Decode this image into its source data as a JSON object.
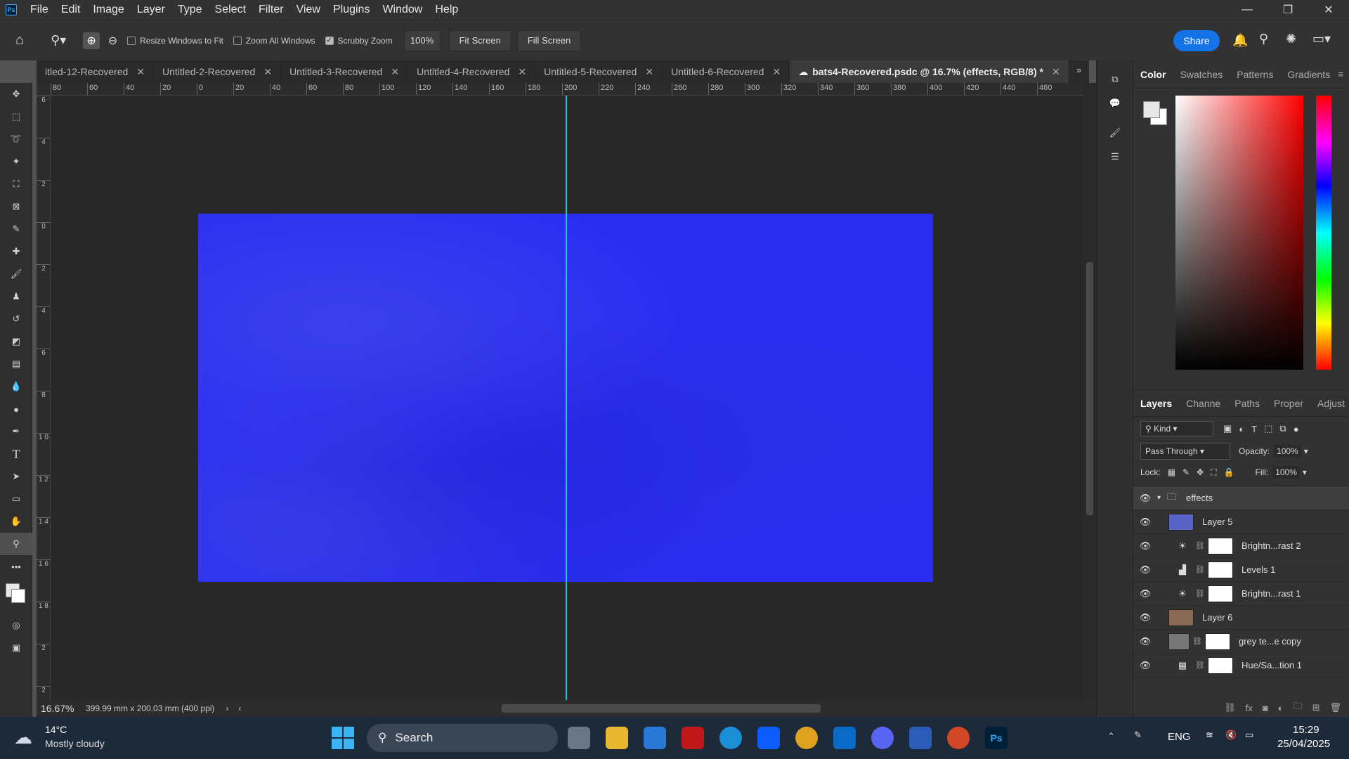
{
  "menubar": {
    "logo": "Ps",
    "items": [
      "File",
      "Edit",
      "Image",
      "Layer",
      "Type",
      "Select",
      "Filter",
      "View",
      "Plugins",
      "Window",
      "Help"
    ],
    "window_controls": [
      "—",
      "❐",
      "✕"
    ]
  },
  "options": {
    "resize_windows": "Resize Windows to Fit",
    "zoom_all": "Zoom All Windows",
    "scrubby_zoom": "Scrubby Zoom",
    "zoom_value": "100%",
    "fit_screen": "Fit Screen",
    "fill_screen": "Fill Screen",
    "share": "Share"
  },
  "tabs": [
    {
      "label": "itled-12-Recovered",
      "active": false
    },
    {
      "label": "Untitled-2-Recovered",
      "active": false
    },
    {
      "label": "Untitled-3-Recovered",
      "active": false
    },
    {
      "label": "Untitled-4-Recovered",
      "active": false
    },
    {
      "label": "Untitled-5-Recovered",
      "active": false
    },
    {
      "label": "Untitled-6-Recovered",
      "active": false
    },
    {
      "label": "bats4-Recovered.psdc @ 16.7% (effects, RGB/8) *",
      "active": true
    }
  ],
  "ruler": {
    "h_ticks": [
      "80",
      "60",
      "40",
      "20",
      "0",
      "20",
      "40",
      "60",
      "80",
      "100",
      "120",
      "140",
      "160",
      "180",
      "200",
      "220",
      "240",
      "260",
      "280",
      "300",
      "320",
      "340",
      "360",
      "380",
      "400",
      "420",
      "440",
      "460"
    ],
    "v_ticks": [
      "6",
      "4",
      "2",
      "0",
      "2",
      "4",
      "6",
      "8",
      "1 0",
      "1 2",
      "1 4",
      "1 6",
      "1 8",
      "2",
      "2"
    ]
  },
  "status": {
    "zoom": "16.67%",
    "doc_size": "399.99 mm x 200.03 mm (400 ppi)"
  },
  "color_panel": {
    "tabs": [
      "Color",
      "Swatches",
      "Patterns",
      "Gradients"
    ],
    "foreground": "#e8e8e8",
    "background": "#ffffff"
  },
  "layers_panel": {
    "tabs": [
      "Layers",
      "Channe",
      "Paths",
      "Proper",
      "Adjust"
    ],
    "filter_kind": "Kind",
    "blend_mode": "Pass Through",
    "opacity_label": "Opacity:",
    "opacity": "100%",
    "lock_label": "Lock:",
    "fill_label": "Fill:",
    "fill": "100%",
    "layers": [
      {
        "name": "effects",
        "kind": "group"
      },
      {
        "name": "Layer 5",
        "kind": "pixel",
        "color": "#5a63c8"
      },
      {
        "name": "Brightn...rast 2",
        "kind": "adjust",
        "icon": "☀"
      },
      {
        "name": "Levels 1",
        "kind": "adjust",
        "icon": "▟"
      },
      {
        "name": "Brightn...rast 1",
        "kind": "adjust",
        "icon": "☀"
      },
      {
        "name": "Layer 6",
        "kind": "pixel",
        "color": "#8a6a55"
      },
      {
        "name": "grey te...e copy",
        "kind": "smart",
        "color": "#777777"
      },
      {
        "name": "Hue/Sa...tion 1",
        "kind": "adjust",
        "icon": "▦"
      }
    ]
  },
  "taskbar": {
    "weather_temp": "14°C",
    "weather_desc": "Mostly cloudy",
    "search": "Search",
    "lang": "ENG",
    "time": "15:29",
    "date": "25/04/2025",
    "apps": [
      "Ps"
    ]
  }
}
